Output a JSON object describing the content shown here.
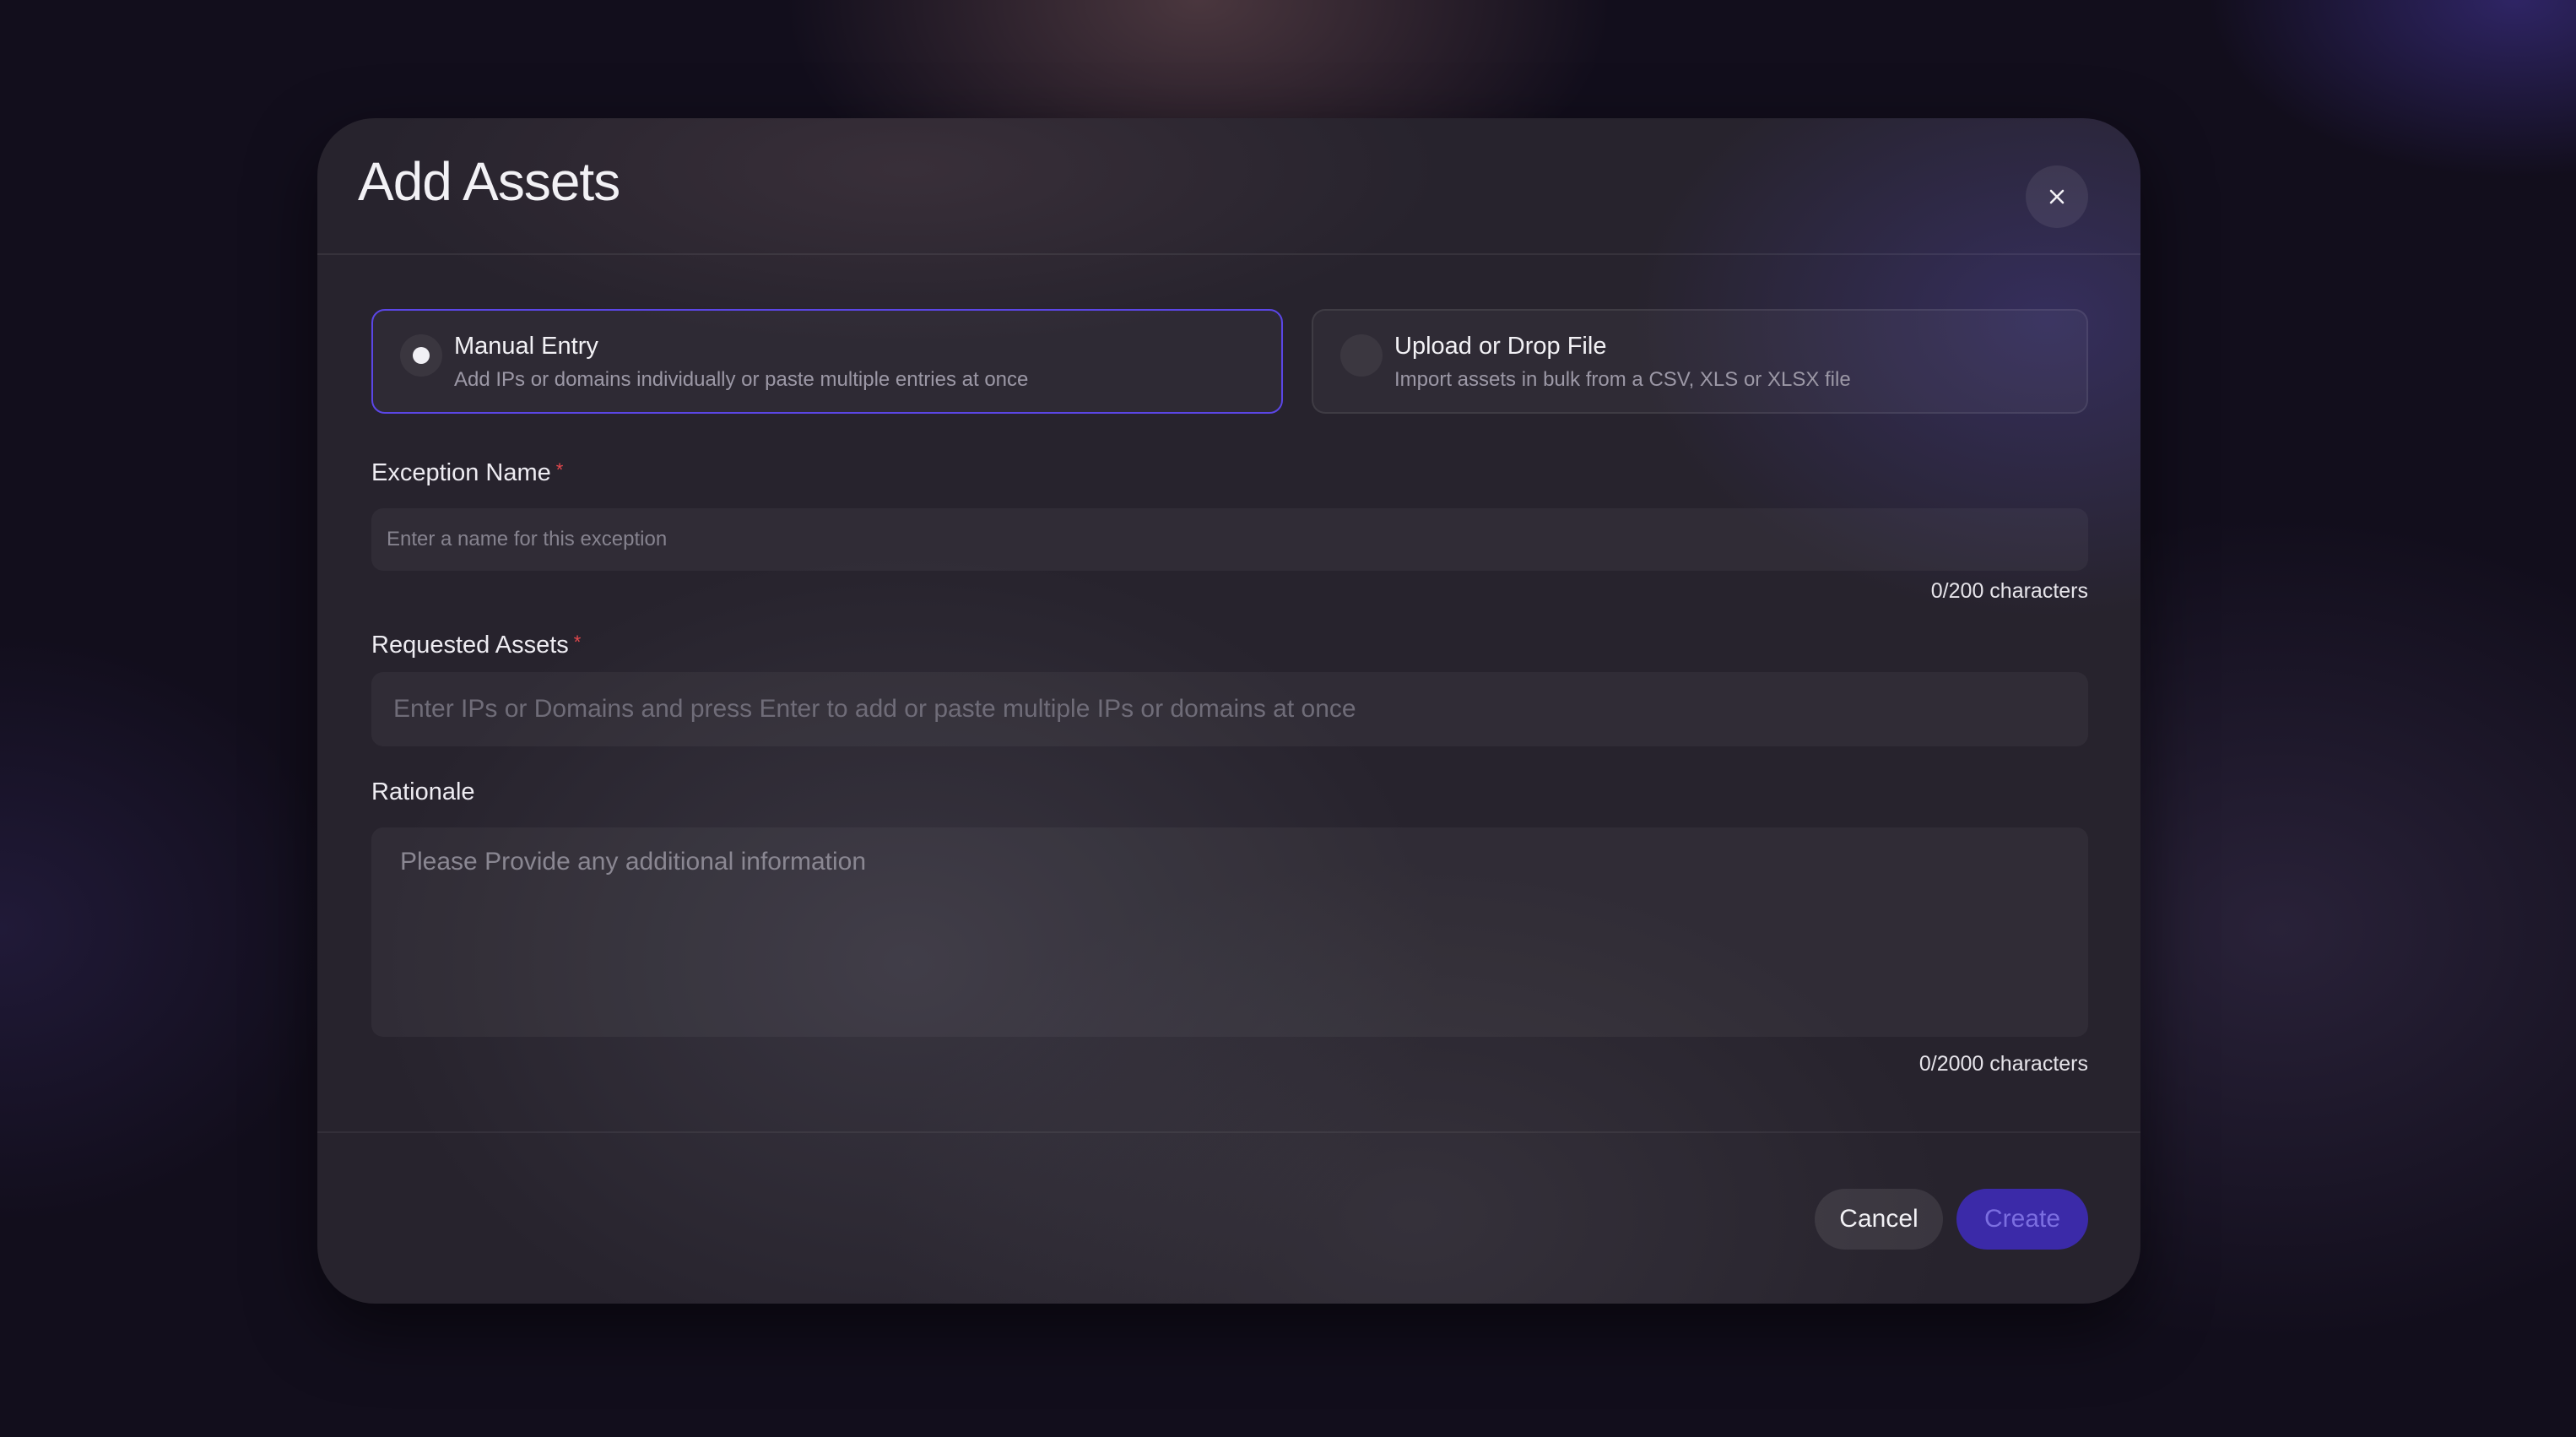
{
  "modal": {
    "title": "Add Assets",
    "close_icon": "close-icon"
  },
  "entry_options": [
    {
      "title": "Manual Entry",
      "description": "Add IPs or domains individually or paste multiple entries at once",
      "selected": true
    },
    {
      "title": "Upload or Drop File",
      "description": "Import assets in bulk from a CSV, XLS or XLSX file",
      "selected": false
    }
  ],
  "form": {
    "exception_name": {
      "label": "Exception Name",
      "required_mark": "*",
      "value": "",
      "placeholder": "Enter a name for this exception",
      "counter": "0/200 characters"
    },
    "requested_assets": {
      "label": "Requested Assets",
      "required_mark": "*",
      "value": "",
      "placeholder": "Enter IPs or Domains and press Enter to add or paste multiple IPs or domains at once"
    },
    "rationale": {
      "label": "Rationale",
      "value": "",
      "placeholder": "Please Provide any additional information",
      "counter": "0/2000 characters"
    }
  },
  "actions": {
    "cancel_label": "Cancel",
    "create_label": "Create"
  },
  "colors": {
    "accent": "#5b46e6",
    "create_button_bg": "#3b2aa8",
    "required": "#e5484d"
  }
}
